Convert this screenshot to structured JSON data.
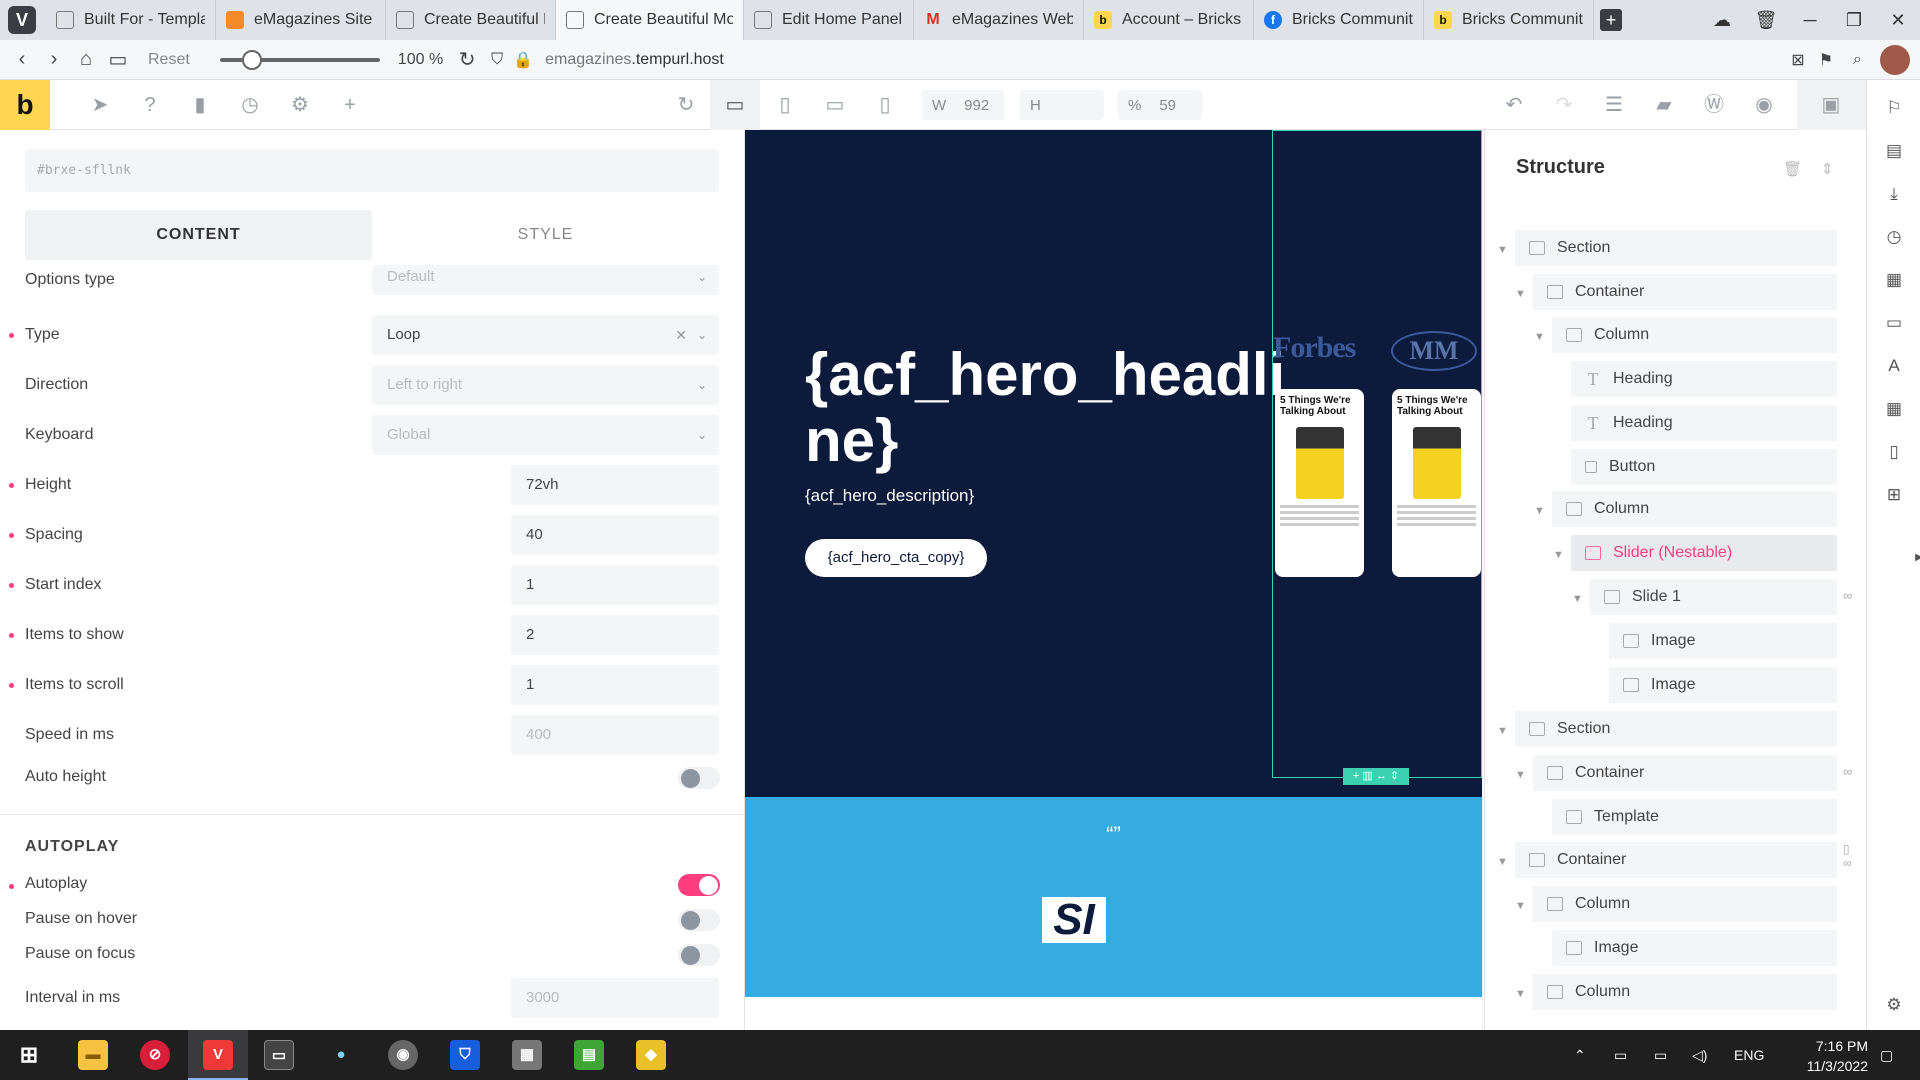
{
  "browser": {
    "tabs": [
      {
        "label": "Built For - Template",
        "active": false
      },
      {
        "label": "eMagazines Site Re",
        "active": false
      },
      {
        "label": "Create Beautiful Mc",
        "active": false
      },
      {
        "label": "Create Beautiful Mob",
        "active": true
      },
      {
        "label": "Edit Home Panel \"a",
        "active": false
      },
      {
        "label": "eMagazines Websit",
        "active": false
      },
      {
        "label": "Account – Bricks",
        "active": false
      },
      {
        "label": "Bricks Community",
        "active": false
      },
      {
        "label": "Bricks Community",
        "active": false
      }
    ],
    "reset_label": "Reset",
    "zoom": "100 %",
    "url_domain": "emagazines",
    "url_rest": ".tempurl.host"
  },
  "toolbar": {
    "logo": "b",
    "width_label": "W",
    "width_value": "992",
    "height_label": "H",
    "percent_label": "%",
    "percent_value": "59"
  },
  "left_panel": {
    "element_id": "#brxe-sfllnk",
    "tab_content": "CONTENT",
    "tab_style": "STYLE",
    "options_type": {
      "label": "Options type",
      "value": "Default"
    },
    "type": {
      "label": "Type",
      "value": "Loop"
    },
    "direction": {
      "label": "Direction",
      "value": "Left to right"
    },
    "keyboard": {
      "label": "Keyboard",
      "value": "Global"
    },
    "height": {
      "label": "Height",
      "value": "72vh"
    },
    "spacing": {
      "label": "Spacing",
      "value": "40"
    },
    "start_index": {
      "label": "Start index",
      "value": "1"
    },
    "items_to_show": {
      "label": "Items to show",
      "value": "2"
    },
    "items_to_scroll": {
      "label": "Items to scroll",
      "value": "1"
    },
    "speed": {
      "label": "Speed in ms",
      "placeholder": "400"
    },
    "auto_height": {
      "label": "Auto height",
      "on": false
    },
    "autoplay_heading": "AUTOPLAY",
    "autoplay": {
      "label": "Autoplay",
      "on": true
    },
    "pause_hover": {
      "label": "Pause on hover",
      "on": false
    },
    "pause_focus": {
      "label": "Pause on focus",
      "on": false
    },
    "interval": {
      "label": "Interval in ms",
      "placeholder": "3000"
    }
  },
  "canvas": {
    "headline": "{acf_hero_headli ne}",
    "description": "{acf_hero_description}",
    "cta": "{acf_hero_cta_copy}",
    "brand_forbes": "Forbes",
    "magazine_title": "5 Things We're Talking About",
    "quote_mark": "“”",
    "si_logo": "SI",
    "hero_bg": "#0c1b3c",
    "quote_bg": "#35abe2"
  },
  "structure": {
    "title": "Structure",
    "nodes": [
      {
        "label": "Section",
        "icon": "section-icon"
      },
      {
        "label": "Container",
        "icon": "container-icon"
      },
      {
        "label": "Column",
        "icon": "column-icon"
      },
      {
        "label": "Heading",
        "icon": "heading-icon"
      },
      {
        "label": "Heading",
        "icon": "heading-icon"
      },
      {
        "label": "Button",
        "icon": "button-icon"
      },
      {
        "label": "Column",
        "icon": "column-icon"
      },
      {
        "label": "Slider (Nestable)",
        "icon": "slider-icon"
      },
      {
        "label": "Slide 1",
        "icon": "container-icon"
      },
      {
        "label": "Image",
        "icon": "image-icon"
      },
      {
        "label": "Image",
        "icon": "image-icon"
      },
      {
        "label": "Section",
        "icon": "section-icon"
      },
      {
        "label": "Container",
        "icon": "container-icon"
      },
      {
        "label": "Template",
        "icon": "template-icon"
      },
      {
        "label": "Container",
        "icon": "container-icon"
      },
      {
        "label": "Column",
        "icon": "column-icon"
      },
      {
        "label": "Image",
        "icon": "image-icon"
      },
      {
        "label": "Column",
        "icon": "column-icon"
      }
    ]
  },
  "taskbar": {
    "language": "ENG",
    "time": "7:16 PM",
    "date": "11/3/2022"
  },
  "colors": {
    "accent": "#ff3d7f",
    "brand": "#ffd64f"
  }
}
